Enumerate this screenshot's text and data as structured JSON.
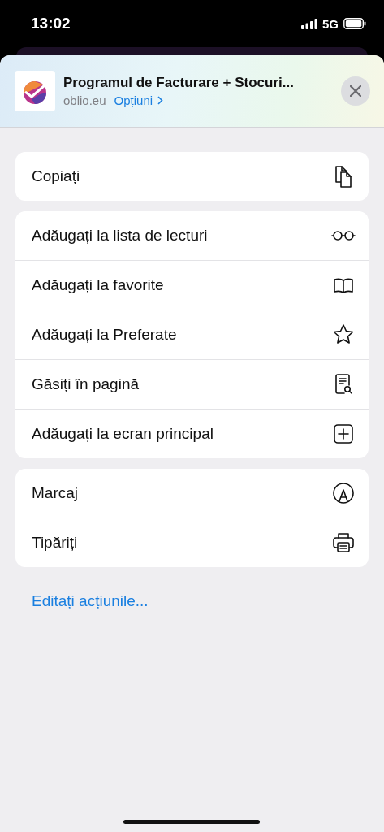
{
  "status_bar": {
    "time": "13:02",
    "network": "5G"
  },
  "header": {
    "title": "Programul de Facturare + Stocuri...",
    "domain": "oblio.eu",
    "options_link": "Opțiuni"
  },
  "groups": [
    {
      "items": [
        {
          "label": "Copiați",
          "kind": "copy"
        }
      ]
    },
    {
      "items": [
        {
          "label": "Adăugați la lista de lecturi",
          "kind": "glasses"
        },
        {
          "label": "Adăugați la favorite",
          "kind": "book"
        },
        {
          "label": "Adăugați la Preferate",
          "kind": "star"
        },
        {
          "label": "Găsiți în pagină",
          "kind": "find"
        },
        {
          "label": "Adăugați la ecran principal",
          "kind": "add"
        }
      ]
    },
    {
      "items": [
        {
          "label": "Marcaj",
          "kind": "markup"
        },
        {
          "label": "Tipăriți",
          "kind": "print"
        }
      ]
    }
  ],
  "edit_link": "Editați acțiunile..."
}
